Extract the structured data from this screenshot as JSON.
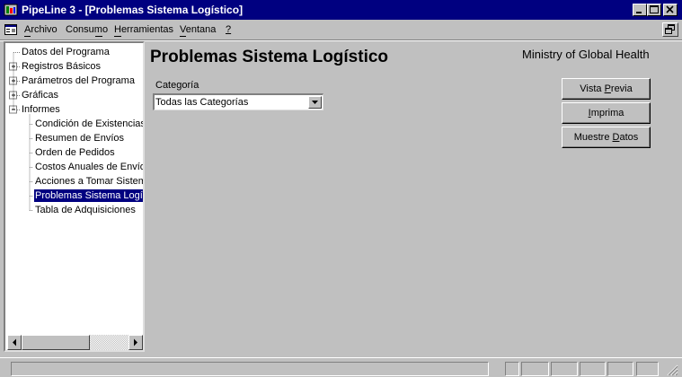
{
  "window": {
    "title": "PipeLine 3 - [Problemas Sistema Logístico]",
    "title_bar_color": "#000080",
    "icons": [
      "pipeline-app-icon",
      "minimize-icon",
      "maximize-icon",
      "close-icon",
      "restore-icon"
    ]
  },
  "menu": {
    "items": [
      {
        "label": "Archivo",
        "accel": "A"
      },
      {
        "label": "Consumo",
        "accel": "m"
      },
      {
        "label": "Herramientas",
        "accel": "H"
      },
      {
        "label": "Ventana",
        "accel": "V"
      },
      {
        "label": "?",
        "accel": "?"
      }
    ]
  },
  "tree": {
    "nodes": [
      {
        "label": "Datos del Programa",
        "expander": "none",
        "selected": false
      },
      {
        "label": "Registros Básicos",
        "expander": "+",
        "selected": false
      },
      {
        "label": "Parámetros del Programa",
        "expander": "+",
        "selected": false
      },
      {
        "label": "Gráficas",
        "expander": "+",
        "selected": false
      },
      {
        "label": "Informes",
        "expander": "-",
        "selected": false
      },
      {
        "label": "Condición de Existencias",
        "expander": "child",
        "selected": false
      },
      {
        "label": "Resumen de Envíos",
        "expander": "child",
        "selected": false
      },
      {
        "label": "Orden de Pedidos",
        "expander": "child",
        "selected": false
      },
      {
        "label": "Costos Anuales de Envío",
        "expander": "child",
        "selected": false
      },
      {
        "label": "Acciones a Tomar Sistem",
        "expander": "child",
        "selected": false
      },
      {
        "label": "Problemas Sistema Logís",
        "expander": "child",
        "selected": true
      },
      {
        "label": "Tabla de Adquisiciones",
        "expander": "child",
        "selected": false
      }
    ],
    "selection_color": "#000080"
  },
  "main": {
    "title": "Problemas Sistema Logístico",
    "organization": "Ministry of Global Health",
    "category": {
      "label": "Categoría",
      "selected": "Todas las Categorías"
    },
    "buttons": [
      {
        "label": "Vista Previa",
        "accel": "P"
      },
      {
        "label": "Imprima",
        "accel": "I"
      },
      {
        "label": "Muestre Datos",
        "accel": "D"
      }
    ]
  }
}
